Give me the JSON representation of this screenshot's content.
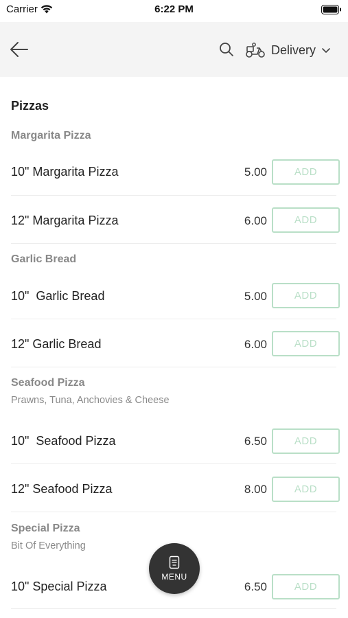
{
  "status_bar": {
    "carrier": "Carrier",
    "time": "6:22 PM"
  },
  "header": {
    "delivery_label": "Delivery"
  },
  "section": {
    "title": "Pizzas"
  },
  "groups": [
    {
      "title": "Margarita Pizza",
      "description": "",
      "items": [
        {
          "name": "10\" Margarita Pizza",
          "price": "5.00"
        },
        {
          "name": "12\" Margarita Pizza",
          "price": "6.00"
        }
      ]
    },
    {
      "title": "Garlic Bread",
      "description": "",
      "items": [
        {
          "name": "10\"  Garlic Bread",
          "price": "5.00"
        },
        {
          "name": "12\" Garlic Bread",
          "price": "6.00"
        }
      ]
    },
    {
      "title": "Seafood Pizza",
      "description": "Prawns, Tuna, Anchovies & Cheese",
      "items": [
        {
          "name": "10\"  Seafood Pizza",
          "price": "6.50"
        },
        {
          "name": "12\" Seafood Pizza",
          "price": "8.00"
        }
      ]
    },
    {
      "title": "Special Pizza",
      "description": "Bit Of Everything",
      "items": [
        {
          "name": "10\" Special Pizza",
          "price": "6.50"
        }
      ]
    }
  ],
  "add_label": "ADD",
  "menu_fab": {
    "label": "MENU"
  },
  "colors": {
    "header_bg": "#f4f4f4",
    "add_border": "#b9dfc7",
    "fab_bg": "#333333"
  }
}
